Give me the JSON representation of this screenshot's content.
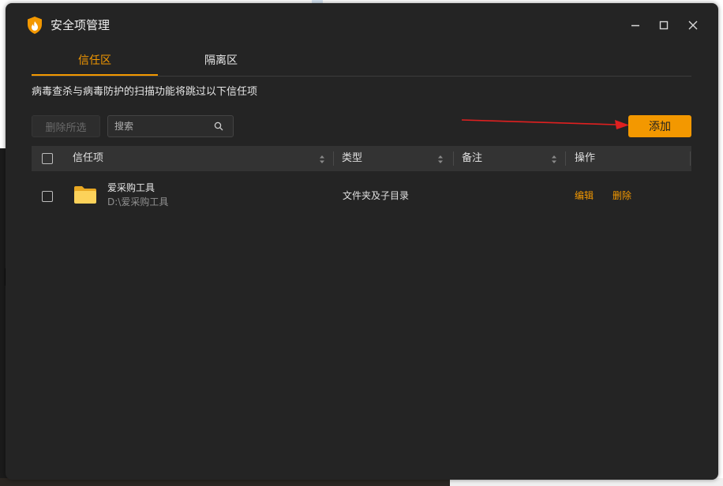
{
  "window": {
    "title": "安全项管理"
  },
  "tabs": [
    {
      "label": "信任区",
      "active": true
    },
    {
      "label": "隔离区",
      "active": false
    }
  ],
  "description": "病毒查杀与病毒防护的扫描功能将跳过以下信任项",
  "toolbar": {
    "delete_selected_label": "删除所选",
    "search_placeholder": "搜索",
    "add_label": "添加"
  },
  "table": {
    "headers": {
      "name": "信任项",
      "type": "类型",
      "note": "备注",
      "actions": "操作"
    },
    "rows": [
      {
        "name": "爱采购工具",
        "path": "D:\\爱采购工具",
        "type": "文件夹及子目录",
        "note": "",
        "actions": {
          "edit": "编辑",
          "delete": "删除"
        }
      }
    ]
  },
  "colors": {
    "accent": "#f39800",
    "window_bg": "#242424",
    "header_bg": "#333333",
    "annotation_arrow": "#e02020"
  }
}
